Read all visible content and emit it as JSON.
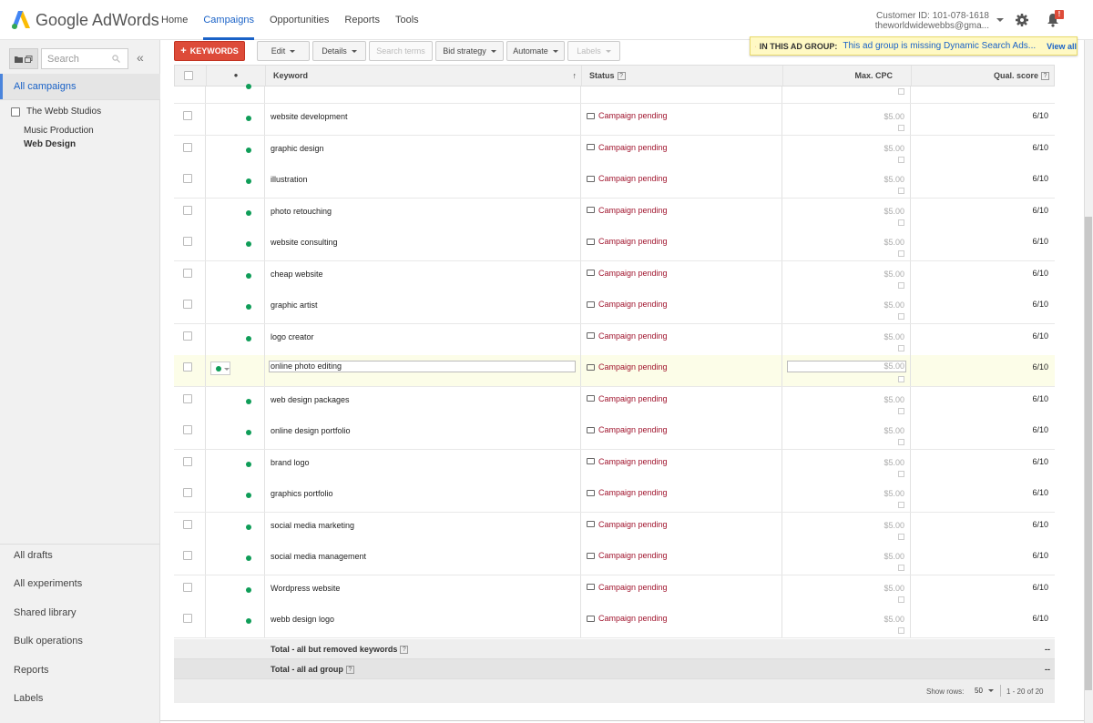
{
  "app": {
    "logo_text": "Google AdWords"
  },
  "nav": {
    "items": [
      "Home",
      "Campaigns",
      "Opportunities",
      "Reports",
      "Tools"
    ],
    "active": "Campaigns"
  },
  "account": {
    "customer_id": "Customer ID: 101-078-1618",
    "email": "theworldwidewebbs@gma..."
  },
  "notifications": {
    "badge": "!"
  },
  "sidebar": {
    "search_placeholder": "Search",
    "collapse": "«",
    "all_campaigns": "All campaigns",
    "account_name": "The Webb Studios",
    "campaigns": [
      "Music Production",
      "Web Design"
    ],
    "selected": "Web Design",
    "links": [
      "All drafts",
      "All experiments",
      "Shared library",
      "Bulk operations",
      "Reports",
      "Labels"
    ]
  },
  "toolbar": {
    "keywords": "KEYWORDS",
    "edit": "Edit",
    "details": "Details",
    "search_terms": "Search terms",
    "bid_strategy": "Bid strategy",
    "automate": "Automate",
    "labels": "Labels"
  },
  "alert": {
    "label": "IN THIS AD GROUP:",
    "message": "This ad group is missing Dynamic Search Ads...",
    "view_all": "View all"
  },
  "table": {
    "headers": {
      "status_dot": "●",
      "keyword": "Keyword",
      "sort": "↑",
      "status": "Status",
      "max_cpc": "Max. CPC",
      "qual_score": "Qual. score",
      "help": "?"
    },
    "rows": [
      {
        "keyword": "website development",
        "status": "Campaign pending",
        "cpc": "$5.00",
        "qs": "6/10"
      },
      {
        "keyword": "graphic design",
        "status": "Campaign pending",
        "cpc": "$5.00",
        "qs": "6/10"
      },
      {
        "keyword": "illustration",
        "status": "Campaign pending",
        "cpc": "$5.00",
        "qs": "6/10"
      },
      {
        "keyword": "photo retouching",
        "status": "Campaign pending",
        "cpc": "$5.00",
        "qs": "6/10"
      },
      {
        "keyword": "website consulting",
        "status": "Campaign pending",
        "cpc": "$5.00",
        "qs": "6/10"
      },
      {
        "keyword": "cheap website",
        "status": "Campaign pending",
        "cpc": "$5.00",
        "qs": "6/10"
      },
      {
        "keyword": "graphic artist",
        "status": "Campaign pending",
        "cpc": "$5.00",
        "qs": "6/10"
      },
      {
        "keyword": "logo creator",
        "status": "Campaign pending",
        "cpc": "$5.00",
        "qs": "6/10"
      },
      {
        "keyword": "online photo editing",
        "status": "Campaign pending",
        "cpc": "$5.00",
        "qs": "6/10",
        "selected": true
      },
      {
        "keyword": "web design packages",
        "status": "Campaign pending",
        "cpc": "$5.00",
        "qs": "6/10"
      },
      {
        "keyword": "online design portfolio",
        "status": "Campaign pending",
        "cpc": "$5.00",
        "qs": "6/10"
      },
      {
        "keyword": "brand logo",
        "status": "Campaign pending",
        "cpc": "$5.00",
        "qs": "6/10"
      },
      {
        "keyword": "graphics portfolio",
        "status": "Campaign pending",
        "cpc": "$5.00",
        "qs": "6/10"
      },
      {
        "keyword": "social media marketing",
        "status": "Campaign pending",
        "cpc": "$5.00",
        "qs": "6/10"
      },
      {
        "keyword": "social media management",
        "status": "Campaign pending",
        "cpc": "$5.00",
        "qs": "6/10"
      },
      {
        "keyword": "Wordpress website",
        "status": "Campaign pending",
        "cpc": "$5.00",
        "qs": "6/10"
      },
      {
        "keyword": "webb design logo",
        "status": "Campaign pending",
        "cpc": "$5.00",
        "qs": "6/10"
      }
    ],
    "total_all_but_removed": "Total - all but removed keywords",
    "total_ad_group": "Total - all ad group",
    "total_value": "--"
  },
  "pagination": {
    "show_rows_label": "Show rows:",
    "rows": "50",
    "range": "1 - 20 of 20"
  },
  "colors": {
    "accent": "#1a62c7",
    "primary_button": "#dd4b39",
    "enabled_dot": "#0f9d58",
    "status_text": "#a0142d",
    "alert_bg": "#fff9c4"
  }
}
